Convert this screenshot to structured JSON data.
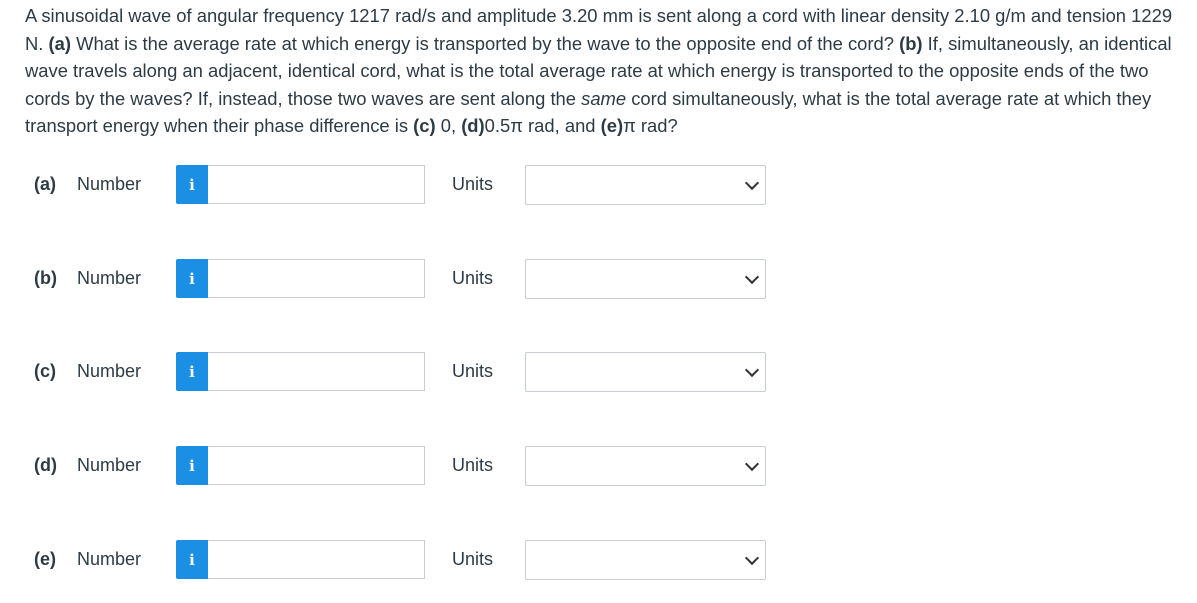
{
  "question": {
    "p1": "A sinusoidal wave of angular frequency 1217 rad/s and amplitude 3.20 mm is sent along a cord with linear density 2.10 g/m and tension 1229 N. ",
    "a_tag": "(a)",
    "p2": " What is the average rate at which energy is transported by the wave to the opposite end of the cord? ",
    "b_tag": "(b)",
    "p3": " If, simultaneously, an identical wave travels along an adjacent, identical cord, what is the total average rate at which energy is transported to the opposite ends of the two cords by the waves? If, instead, those two waves are sent along the ",
    "same": "same",
    "p4": " cord simultaneously, what is the total average rate at which they transport energy when their phase difference is ",
    "c_tag": "(c)",
    "p5": " 0, ",
    "d_tag": "(d)",
    "p6": "0.5π rad, and ",
    "e_tag": "(e)",
    "p7": "π rad?"
  },
  "parts": [
    {
      "label": "(a)",
      "number_label": "Number",
      "info": "i",
      "value": "",
      "units_label": "Units",
      "units_selected": ""
    },
    {
      "label": "(b)",
      "number_label": "Number",
      "info": "i",
      "value": "",
      "units_label": "Units",
      "units_selected": ""
    },
    {
      "label": "(c)",
      "number_label": "Number",
      "info": "i",
      "value": "",
      "units_label": "Units",
      "units_selected": ""
    },
    {
      "label": "(d)",
      "number_label": "Number",
      "info": "i",
      "value": "",
      "units_label": "Units",
      "units_selected": ""
    },
    {
      "label": "(e)",
      "number_label": "Number",
      "info": "i",
      "value": "",
      "units_label": "Units",
      "units_selected": ""
    }
  ],
  "colors": {
    "info_button": "#1a8fe3",
    "text": "#2d3b45",
    "border": "#c7cdd1"
  }
}
